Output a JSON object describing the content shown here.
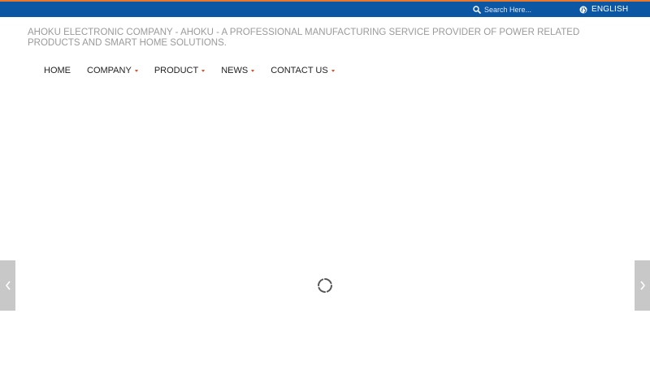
{
  "header": {
    "search": {
      "placeholder": "Search Here..."
    },
    "language": {
      "label": "ENGLISH"
    },
    "colors": {
      "topbar": "#0b57a4",
      "accent_strip": "#e8772e",
      "caret": "#e0512b"
    }
  },
  "tagline": "AHOKU ELECTRONIC COMPANY - AHOKU - A PROFESSIONAL MANUFACTURING SERVICE PROVIDER OF POWER RELATED PRODUCTS AND SMART HOME SOLUTIONS.",
  "nav": {
    "items": [
      {
        "label": "HOME",
        "has_dropdown": false
      },
      {
        "label": "COMPANY",
        "has_dropdown": true
      },
      {
        "label": "PRODUCT",
        "has_dropdown": true
      },
      {
        "label": "NEWS",
        "has_dropdown": true
      },
      {
        "label": "CONTACT US",
        "has_dropdown": true
      }
    ]
  },
  "slider": {
    "prev_icon": "chevron-left-icon",
    "next_icon": "chevron-right-icon",
    "loading_icon": "spinner-icon"
  }
}
